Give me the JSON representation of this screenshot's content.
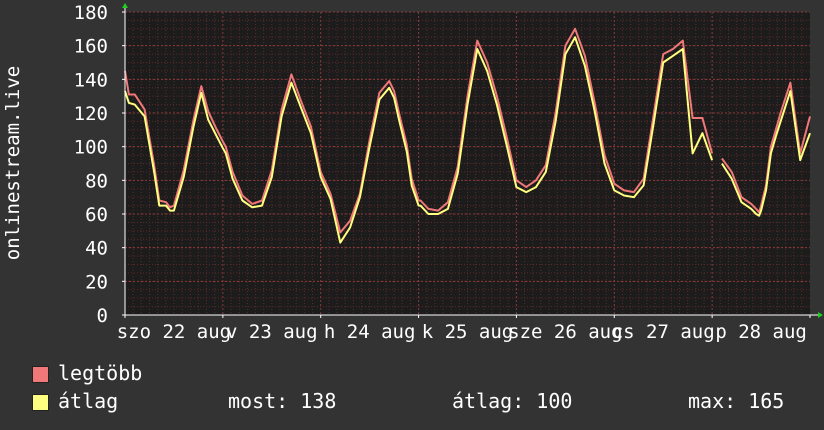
{
  "chart_data": {
    "type": "line",
    "ylabel": "onlinestream.live",
    "ylim": [
      0,
      180
    ],
    "yticks": [
      0,
      20,
      40,
      60,
      80,
      100,
      120,
      140,
      160,
      180
    ],
    "grid": true,
    "xlim": [
      0,
      7
    ],
    "xtick_labels": [
      {
        "label": "szo 22 aug",
        "pos": 0.5
      },
      {
        "label": "v 23 aug",
        "pos": 1.5
      },
      {
        "label": "h 24 aug",
        "pos": 2.5
      },
      {
        "label": "k 25 aug",
        "pos": 3.5
      },
      {
        "label": "sze 26 aug",
        "pos": 4.5
      },
      {
        "label": "cs 27 aug",
        "pos": 5.5
      },
      {
        "label": "p 28 aug",
        "pos": 6.5
      }
    ],
    "series": [
      {
        "name": "legtöbb",
        "color": "#f07878",
        "x": [
          0,
          0.04,
          0.1,
          0.2,
          0.3,
          0.35,
          0.42,
          0.46,
          0.5,
          0.6,
          0.7,
          0.78,
          0.85,
          0.93,
          1.0,
          1.03,
          1.1,
          1.2,
          1.3,
          1.4,
          1.5,
          1.6,
          1.7,
          1.8,
          1.9,
          2.0,
          2.1,
          2.2,
          2.3,
          2.4,
          2.5,
          2.6,
          2.7,
          2.75,
          2.8,
          2.88,
          2.93,
          3.0,
          3.02,
          3.1,
          3.2,
          3.3,
          3.4,
          3.5,
          3.6,
          3.7,
          3.8,
          3.9,
          4.0,
          4.1,
          4.2,
          4.3,
          4.4,
          4.5,
          4.6,
          4.7,
          4.8,
          4.9,
          5.0,
          5.1,
          5.2,
          5.3,
          5.4,
          5.5,
          5.6,
          5.7,
          5.8,
          5.9,
          6.0,
          6.1,
          6.2,
          6.3,
          6.4,
          6.45,
          6.48,
          6.5,
          6.55,
          6.6,
          6.65,
          6.7,
          6.8,
          6.9,
          7.0
        ],
        "y": [
          145,
          131,
          131,
          122,
          88,
          68,
          67,
          64,
          65,
          86,
          116,
          136,
          121,
          111,
          103,
          100,
          85,
          71,
          66,
          68,
          86,
          122,
          143,
          127,
          112,
          85,
          72,
          49,
          56,
          72,
          104,
          132,
          139,
          133,
          120,
          101,
          81,
          68,
          68,
          63,
          62,
          67,
          88,
          130,
          163,
          150,
          130,
          106,
          80,
          76,
          80,
          89,
          120,
          160,
          170,
          154,
          126,
          95,
          78,
          74,
          73,
          81,
          118,
          155,
          158,
          163,
          117,
          117,
          96,
          93,
          85,
          70,
          66,
          63,
          61,
          65,
          77,
          100,
          110,
          120,
          138,
          96,
          118
        ],
        "gaps": [
          68,
          69
        ]
      },
      {
        "name": "átlag",
        "color": "#ffff80",
        "x": [
          0,
          0.04,
          0.1,
          0.2,
          0.3,
          0.35,
          0.42,
          0.46,
          0.5,
          0.6,
          0.7,
          0.78,
          0.85,
          0.93,
          1.0,
          1.03,
          1.1,
          1.2,
          1.3,
          1.4,
          1.5,
          1.6,
          1.7,
          1.8,
          1.9,
          2.0,
          2.1,
          2.2,
          2.3,
          2.4,
          2.5,
          2.6,
          2.7,
          2.75,
          2.8,
          2.88,
          2.93,
          3.0,
          3.02,
          3.1,
          3.2,
          3.3,
          3.4,
          3.5,
          3.6,
          3.7,
          3.8,
          3.9,
          4.0,
          4.1,
          4.2,
          4.3,
          4.4,
          4.5,
          4.6,
          4.7,
          4.8,
          4.9,
          5.0,
          5.1,
          5.2,
          5.3,
          5.4,
          5.5,
          5.6,
          5.7,
          5.8,
          5.9,
          6.0,
          6.1,
          6.2,
          6.3,
          6.4,
          6.45,
          6.48,
          6.5,
          6.55,
          6.6,
          6.65,
          6.7,
          6.8,
          6.9,
          7.0
        ],
        "y": [
          133,
          126,
          125,
          118,
          84,
          65,
          65,
          62,
          62,
          82,
          112,
          132,
          116,
          107,
          99,
          96,
          81,
          68,
          64,
          65,
          82,
          118,
          138,
          123,
          108,
          82,
          69,
          43,
          52,
          70,
          100,
          128,
          135,
          129,
          116,
          97,
          77,
          65,
          65,
          60,
          60,
          63,
          84,
          125,
          158,
          145,
          125,
          101,
          76,
          73,
          76,
          85,
          115,
          155,
          165,
          148,
          121,
          90,
          74,
          71,
          70,
          77,
          113,
          150,
          154,
          158,
          96,
          108,
          92,
          90,
          81,
          67,
          63,
          60,
          59,
          62,
          74,
          96,
          106,
          115,
          133,
          92,
          108
        ],
        "gaps": [
          68,
          69
        ]
      }
    ],
    "legend": [
      {
        "label": "legtöbb",
        "color": "#f07878"
      },
      {
        "label": "átlag",
        "color": "#ffff80"
      }
    ],
    "stats": {
      "most": "most: 138",
      "atlag": "átlag: 100",
      "max": "max: 165"
    }
  }
}
